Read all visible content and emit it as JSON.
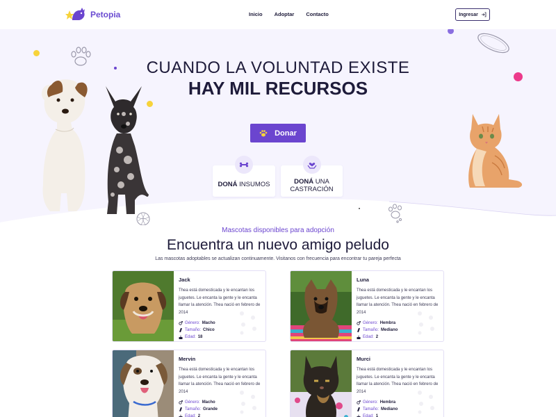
{
  "header": {
    "brand": "Petopia",
    "nav": [
      "Inicio",
      "Adoptar",
      "Contacto"
    ],
    "login_label": "Ingresar"
  },
  "hero": {
    "title_line1": "CUANDO LA VOLUNTAD EXISTE",
    "title_line2": "HAY MIL RECURSOS",
    "donate_label": "Donar",
    "options": [
      {
        "bold": "DONÁ",
        "rest": " INSUMOS",
        "icon": "bone-icon"
      },
      {
        "bold": "DONÁ",
        "rest": " UNA",
        "line2": "CASTRACIÓN",
        "icon": "hands-heart-icon"
      }
    ]
  },
  "section": {
    "subtitle": "Mascotas disponibles para adopción",
    "title": "Encuentra un nuevo amigo peludo",
    "description": "Las mascotas adoptables se actualizan continuamente. Visitanos con frecuencia para encontrar tu pareja perfecta"
  },
  "labels": {
    "gender": "Género:",
    "size": "Tamaño:",
    "age": "Edad:"
  },
  "pets": [
    {
      "name": "Jack",
      "description": "Thea está domesticada y le encantan los juguetes. Le encanta la gente y le encanta llamar la atención. Thea nació en febrero de 2014",
      "gender": "Macho",
      "size": "Chico",
      "age": "18"
    },
    {
      "name": "Luna",
      "description": "Thea está domesticada y le encantan los juguetes. Le encanta la gente y le encanta llamar la atención. Thea nació en febrero de 2014",
      "gender": "Hembra",
      "size": "Mediano",
      "age": "2"
    },
    {
      "name": "Mervin",
      "description": "Thea está domesticada y le encantan los juguetes. Le encanta la gente y le encanta llamar la atención. Thea nació en febrero de 2014",
      "gender": "Macho",
      "size": "Grande",
      "age": "2"
    },
    {
      "name": "Murci",
      "description": "Thea está domesticada y le encantan los juguetes. Le encanta la gente y le encanta llamar la atención. Thea nació en febrero de 2014",
      "gender": "Hembra",
      "size": "Mediano",
      "age": "1"
    }
  ],
  "colors": {
    "accent": "#6b45cf",
    "hero_bg": "#f6f4fe",
    "yellow": "#f7d33b",
    "pink": "#ec3a8b"
  }
}
